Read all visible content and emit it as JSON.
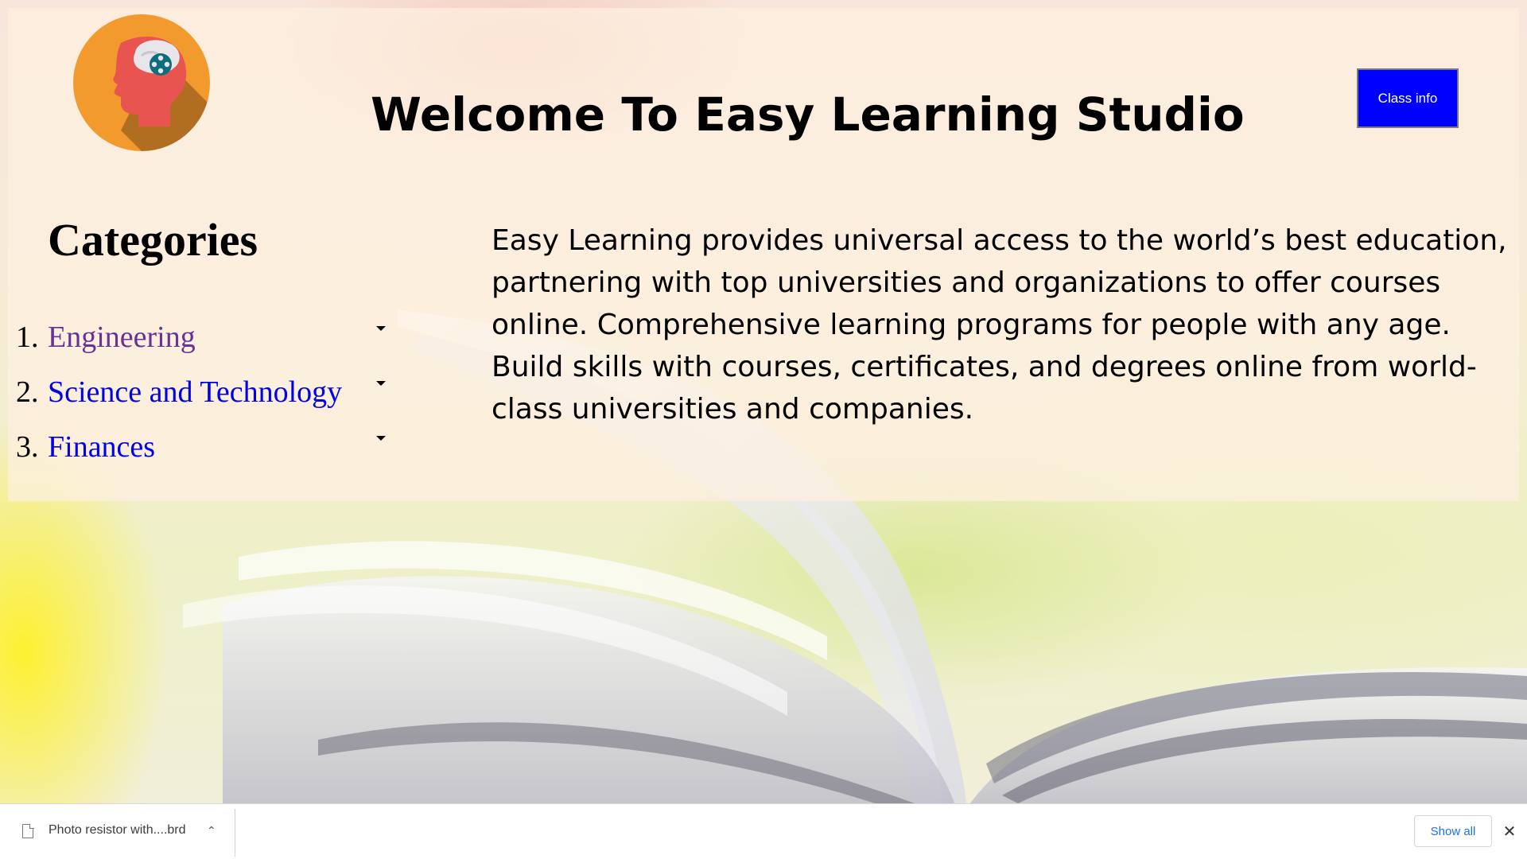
{
  "header": {
    "title": "Welcome To Easy Learning Studio",
    "class_info_label": "Class info",
    "logo_icon": "brain-gamepad-head-icon"
  },
  "categories": {
    "heading": "Categories",
    "items": [
      {
        "number": "1.",
        "label": "Engineering",
        "state": "visited"
      },
      {
        "number": "2.",
        "label": "Science and Technology",
        "state": "link"
      },
      {
        "number": "3.",
        "label": "Finances",
        "state": "link"
      }
    ]
  },
  "description": "Easy Learning provides universal access to the world’s best education, partnering with top universities and organizations to offer courses online. Comprehensive learning programs for people with any age. Build skills with courses, certificates, and degrees online from world-class universities and companies.",
  "download_bar": {
    "file_name": "Photo resistor with....brd",
    "show_all_label": "Show all",
    "file_icon": "file-icon",
    "chevron_icon": "chevron-up-icon",
    "close_icon": "close-icon"
  },
  "colors": {
    "button_bg": "#0000ff",
    "link": "#0000ee",
    "visited_link": "#663399",
    "logo_circle": "#f39a2e",
    "head": "#e85450"
  }
}
